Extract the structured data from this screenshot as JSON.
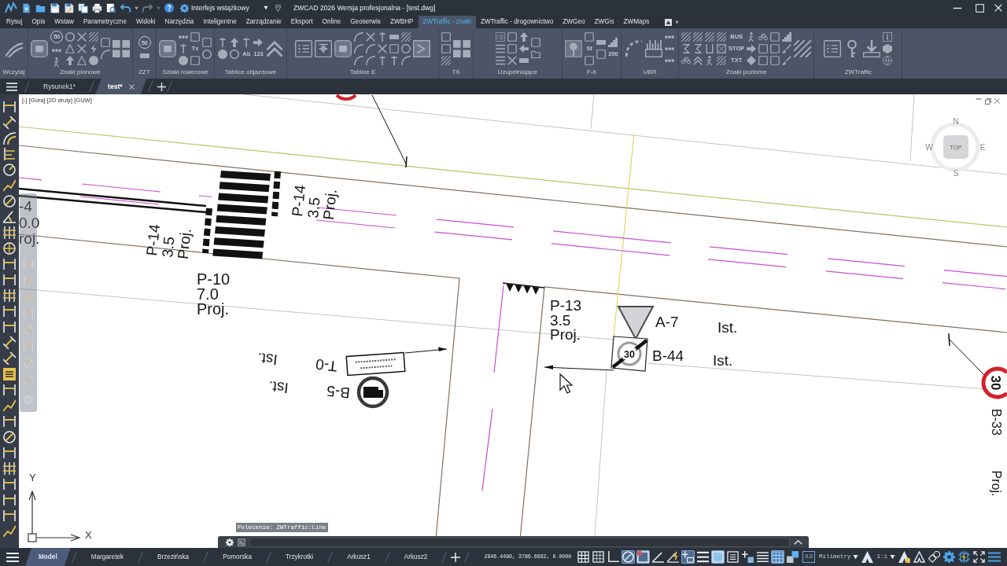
{
  "title_bar": {
    "workspace": "Interfejs wstążkowy",
    "title": "ZWCAD 2026 Wersja profesjonalna - [test.dwg]"
  },
  "menu_tabs": [
    {
      "label": "Rysuj",
      "selected": false
    },
    {
      "label": "Opis",
      "selected": false
    },
    {
      "label": "Wstaw",
      "selected": false
    },
    {
      "label": "Parametryczne",
      "selected": false
    },
    {
      "label": "Widoki",
      "selected": false
    },
    {
      "label": "Narzędzia",
      "selected": false
    },
    {
      "label": "Inteligentne",
      "selected": false
    },
    {
      "label": "Zarządzanie",
      "selected": false
    },
    {
      "label": "Eksport",
      "selected": false
    },
    {
      "label": "Online",
      "selected": false
    },
    {
      "label": "Geoserwis",
      "selected": false
    },
    {
      "label": "ZWBHP",
      "selected": false
    },
    {
      "label": "ZWTraffic - znaki",
      "selected": true
    },
    {
      "label": "ZWTraffic - drogownictwo",
      "selected": false
    },
    {
      "label": "ZWGeo",
      "selected": false
    },
    {
      "label": "ZWGis",
      "selected": false
    },
    {
      "label": "ZWMaps",
      "selected": false
    }
  ],
  "ribbon_panels": [
    {
      "label": "Wczytaj"
    },
    {
      "label": "Znaki pionowe",
      "captions": [
        "50"
      ]
    },
    {
      "label": "ZZT",
      "captions": [
        "50"
      ]
    },
    {
      "label": "Szlaki rowerowe",
      "captions": [
        "Tx"
      ]
    },
    {
      "label": "Tablice objazdowe",
      "captions": [
        "Ab",
        "123"
      ]
    },
    {
      "label": "Tablice E"
    },
    {
      "label": "T6"
    },
    {
      "label": "Uzupełniające"
    },
    {
      "label": "F-6",
      "captions": [
        "St",
        "200"
      ]
    },
    {
      "label": "UBR"
    },
    {
      "label": "Znaki poziome",
      "captions": [
        "BUS",
        "STOP",
        "TXT"
      ]
    },
    {
      "label": "ZWTraffic"
    }
  ],
  "document_tabs": [
    {
      "label": "Rysunek1*",
      "selected": false
    },
    {
      "label": "test*",
      "selected": true
    }
  ],
  "viewport": {
    "label": "[-] [Góra] [2D druty] [GUW]",
    "viewcube": {
      "north": "N",
      "west": "W",
      "face": "TOP",
      "east": "E",
      "south": "S"
    },
    "ucs": {
      "y": "Y",
      "x": "X"
    }
  },
  "drawing": {
    "annotations": [
      {
        "lines": [
          "-4",
          "0.0",
          "roj."
        ]
      },
      {
        "lines": [
          "P-14",
          "3.5",
          "Proj."
        ]
      },
      {
        "lines": [
          "P-14",
          "3.5",
          "Proj."
        ]
      },
      {
        "lines": [
          "P-10",
          "7.0",
          "Proj."
        ]
      },
      {
        "lines": [
          "Ist."
        ]
      },
      {
        "lines": [
          "Ist."
        ]
      },
      {
        "lines": [
          "T-0"
        ]
      },
      {
        "lines": [
          "B-5"
        ]
      },
      {
        "lines": [
          "P-13",
          "3.5",
          "Proj."
        ]
      },
      {
        "lines": [
          "A-7"
        ]
      },
      {
        "lines": [
          "Ist."
        ]
      },
      {
        "lines": [
          "B-44"
        ]
      },
      {
        "lines": [
          "Ist."
        ]
      },
      {
        "lines": [
          "B-33"
        ]
      },
      {
        "lines": [
          "Proj."
        ]
      }
    ],
    "signs": [
      {
        "kind": "round_edge"
      },
      {
        "kind": "plate"
      },
      {
        "kind": "truck_ban"
      },
      {
        "kind": "yield"
      },
      {
        "kind": "zone_end",
        "number": "30"
      },
      {
        "kind": "speed_limit",
        "number": "30"
      }
    ]
  },
  "command_line": {
    "history": "Polecenie: ZWTraffic:Line"
  },
  "layout_tabs": [
    {
      "label": "Model",
      "selected": true
    },
    {
      "label": "Margaretek",
      "selected": false
    },
    {
      "label": "Brzezińska",
      "selected": false
    },
    {
      "label": "Pomorska",
      "selected": false
    },
    {
      "label": "Trzykrotki",
      "selected": false
    },
    {
      "label": "Arkusz1",
      "selected": false
    },
    {
      "label": "Arkusz2",
      "selected": false
    }
  ],
  "status_bar": {
    "coordinates": "2846.4490, 3786.6682, 0.0000",
    "toggles": [
      {
        "on": false
      },
      {
        "on": false
      },
      {
        "on": false
      },
      {
        "on": true
      },
      {
        "on": true
      },
      {
        "on": false
      },
      {
        "on": false
      },
      {
        "on": true
      },
      {
        "on": false
      },
      {
        "on": true
      },
      {
        "on": false
      },
      {
        "on": false
      },
      {
        "on": false
      },
      {
        "on": true
      }
    ],
    "display_precision": "0.0",
    "units": "Milimetry",
    "annotation_scale": "1:1"
  }
}
